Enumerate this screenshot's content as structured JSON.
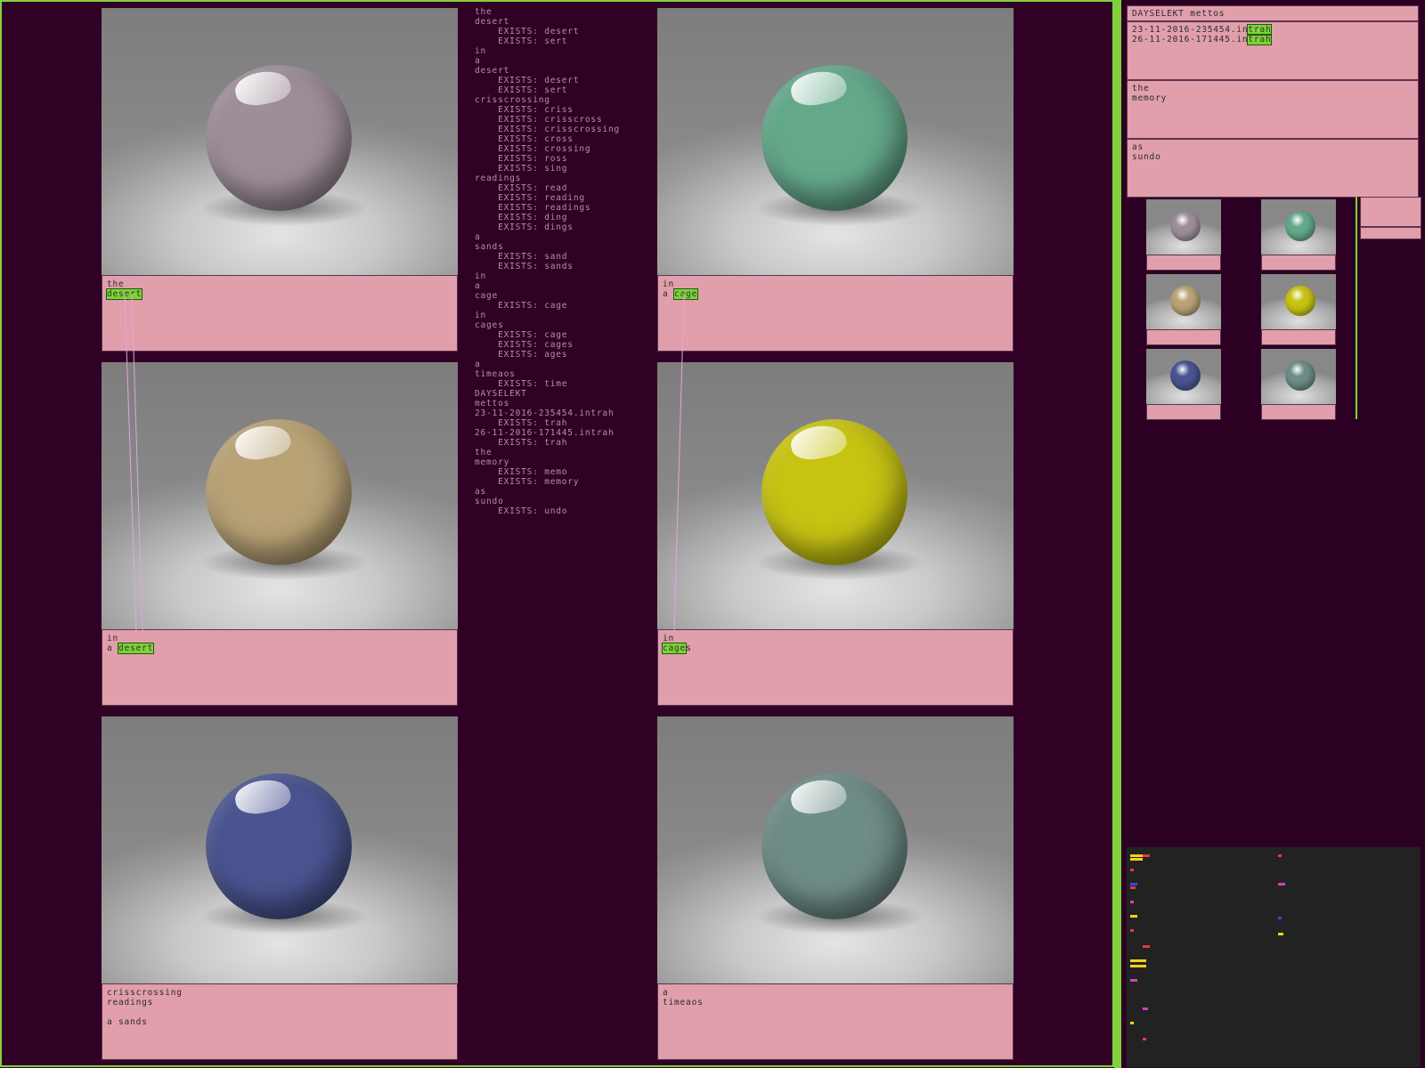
{
  "tiles": [
    {
      "color": "#9e8e9a",
      "caption": [
        "the",
        "desert"
      ]
    },
    {
      "color": "#64a88a",
      "caption": [
        "in",
        "a cage"
      ]
    },
    {
      "color": "#b8a276",
      "caption": [
        "in",
        "a desert"
      ]
    },
    {
      "color": "#c7c313",
      "caption": [
        "in",
        "cages"
      ]
    },
    {
      "color": "#4a5490",
      "caption": [
        "crisscrossing",
        "readings",
        "",
        "a sands"
      ]
    },
    {
      "color": "#6e8c88",
      "caption": [
        "a",
        "timeaos"
      ]
    }
  ],
  "word_list": [
    "the",
    "desert",
    "    EXISTS: desert",
    "    EXISTS: sert",
    "in",
    "a",
    "desert",
    "    EXISTS: desert",
    "    EXISTS: sert",
    "crisscrossing",
    "    EXISTS: criss",
    "    EXISTS: crisscross",
    "    EXISTS: crisscrossing",
    "    EXISTS: cross",
    "    EXISTS: crossing",
    "    EXISTS: ross",
    "    EXISTS: sing",
    "readings",
    "    EXISTS: read",
    "    EXISTS: reading",
    "    EXISTS: readings",
    "    EXISTS: ding",
    "    EXISTS: dings",
    "a",
    "sands",
    "    EXISTS: sand",
    "    EXISTS: sands",
    "in",
    "a",
    "cage",
    "    EXISTS: cage",
    "in",
    "cages",
    "    EXISTS: cage",
    "    EXISTS: cages",
    "    EXISTS: ages",
    "a",
    "timeaos",
    "    EXISTS: time",
    "DAYSELEKT",
    "mettos",
    "23-11-2016-235454.intrah",
    "    EXISTS: trah",
    "26-11-2016-171445.intrah",
    "    EXISTS: trah",
    "the",
    "memory",
    "    EXISTS: memo",
    "    EXISTS: memory",
    "as",
    "sundo",
    "    EXISTS: undo"
  ],
  "right_panel": {
    "header": "DAYSELEKT mettos",
    "files": [
      "23-11-2016-235454.intrah",
      "26-11-2016-171445.intrah"
    ],
    "memory": [
      "the",
      "memory"
    ],
    "sundo": [
      "as",
      "sundo"
    ]
  },
  "colors": {
    "accent": "#7fd13b",
    "caption_bg": "#e19eab",
    "background": "#300025",
    "connector": "#e3a3e0"
  }
}
